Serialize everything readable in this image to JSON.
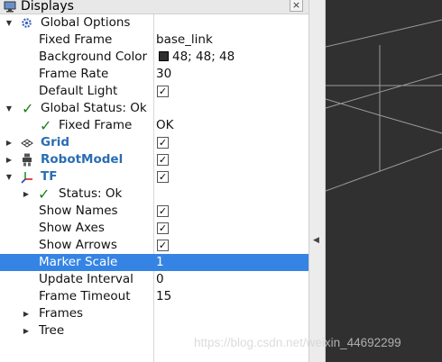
{
  "panel": {
    "title": "Displays",
    "close_label": "×"
  },
  "tree": {
    "global_options": {
      "label": "Global Options",
      "fixed_frame": {
        "label": "Fixed Frame",
        "value": "base_link"
      },
      "background_color": {
        "label": "Background Color",
        "value": "48; 48; 48",
        "color": "#303030"
      },
      "frame_rate": {
        "label": "Frame Rate",
        "value": "30"
      },
      "default_light": {
        "label": "Default Light",
        "checked": "✓"
      }
    },
    "global_status": {
      "label": "Global Status: Ok",
      "fixed_frame": {
        "label": "Fixed Frame",
        "value": "OK"
      }
    },
    "grid": {
      "label": "Grid",
      "checked": "✓"
    },
    "robot_model": {
      "label": "RobotModel",
      "checked": "✓"
    },
    "tf": {
      "label": "TF",
      "checked": "✓",
      "status": {
        "label": "Status: Ok"
      },
      "show_names": {
        "label": "Show Names",
        "checked": "✓"
      },
      "show_axes": {
        "label": "Show Axes",
        "checked": "✓"
      },
      "show_arrows": {
        "label": "Show Arrows",
        "checked": "✓"
      },
      "marker_scale": {
        "label": "Marker Scale",
        "value": "1"
      },
      "update_interval": {
        "label": "Update Interval",
        "value": "0"
      },
      "frame_timeout": {
        "label": "Frame Timeout",
        "value": "15"
      },
      "frames": {
        "label": "Frames"
      },
      "tree_item": {
        "label": "Tree"
      }
    }
  },
  "viewport": {
    "background": "#303030",
    "grid_color": "#a0a0a0"
  },
  "watermark": {
    "text": "https://blog.csdn.net/weixin_44692299"
  }
}
